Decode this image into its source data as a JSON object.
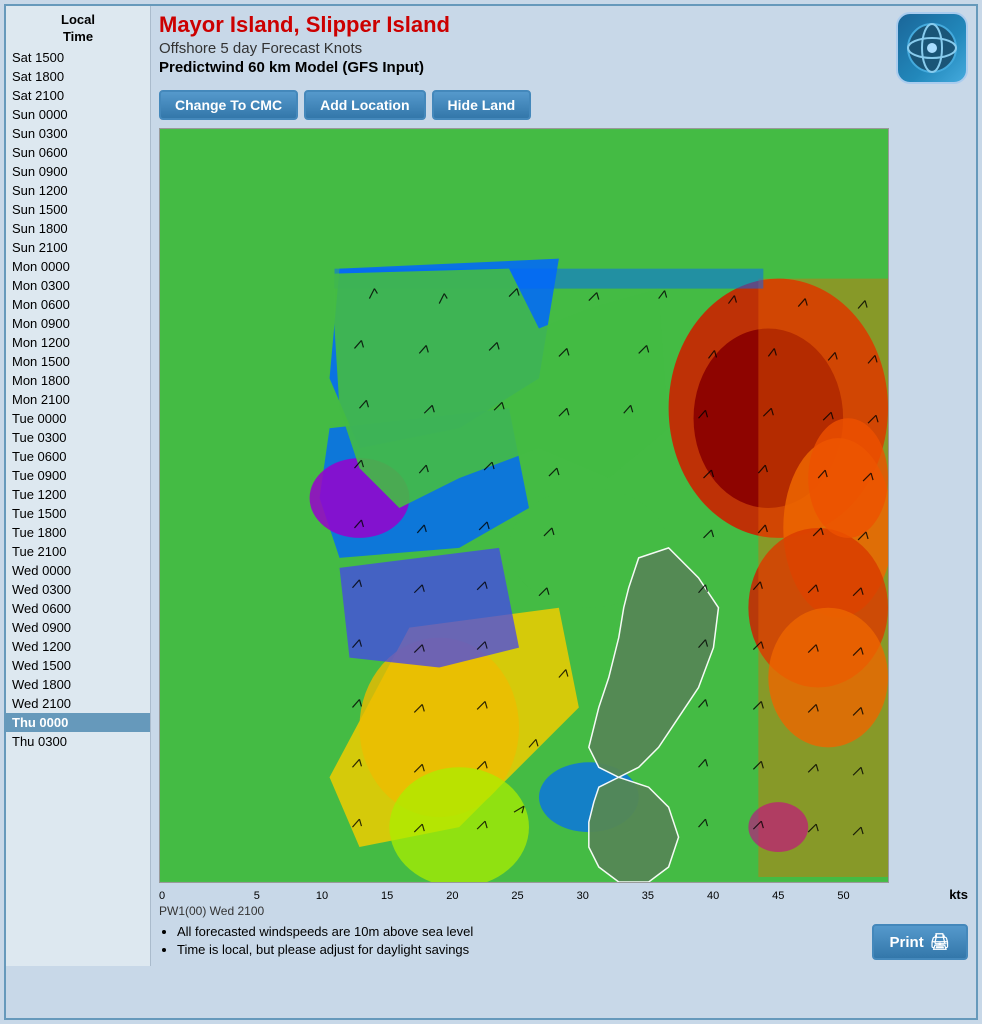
{
  "header": {
    "title": "Mayor Island, Slipper Island",
    "subtitle": "Offshore 5 day Forecast Knots",
    "model": "Predictwind 60 km Model (GFS Input)"
  },
  "toolbar": {
    "btn1": "Change To CMC",
    "btn2": "Add Location",
    "btn3": "Hide Land"
  },
  "sidebar": {
    "header": "Local\nTime",
    "items": [
      "Sat 1500",
      "Sat 1800",
      "Sat 2100",
      "Sun 0000",
      "Sun 0300",
      "Sun 0600",
      "Sun 0900",
      "Sun 1200",
      "Sun 1500",
      "Sun 1800",
      "Sun 2100",
      "Mon 0000",
      "Mon 0300",
      "Mon 0600",
      "Mon 0900",
      "Mon 1200",
      "Mon 1500",
      "Mon 1800",
      "Mon 2100",
      "Tue 0000",
      "Tue 0300",
      "Tue 0600",
      "Tue 0900",
      "Tue 1200",
      "Tue 1500",
      "Tue 1800",
      "Tue 2100",
      "Wed 0000",
      "Wed 0300",
      "Wed 0600",
      "Wed 0900",
      "Wed 1200",
      "Wed 1500",
      "Wed 1800",
      "Wed 2100",
      "Thu 0000",
      "Thu 0300"
    ],
    "activeIndex": 35
  },
  "scale": {
    "colors": [
      "#9900cc",
      "#4444ee",
      "#0066ff",
      "#00aaff",
      "#00cc44",
      "#44ee00",
      "#aaee00",
      "#eebb00",
      "#ee6600",
      "#cc2200",
      "#880000",
      "#444444"
    ],
    "labels": [
      "0",
      "5",
      "10",
      "15",
      "20",
      "25",
      "30",
      "35",
      "40",
      "45",
      "50",
      ""
    ],
    "unit": "kts"
  },
  "timestamp": "PW1(00) Wed 2100",
  "notes": [
    "All forecasted windspeeds are 10m above sea level",
    "Time is local, but please adjust for daylight savings"
  ],
  "print_btn": "Print"
}
